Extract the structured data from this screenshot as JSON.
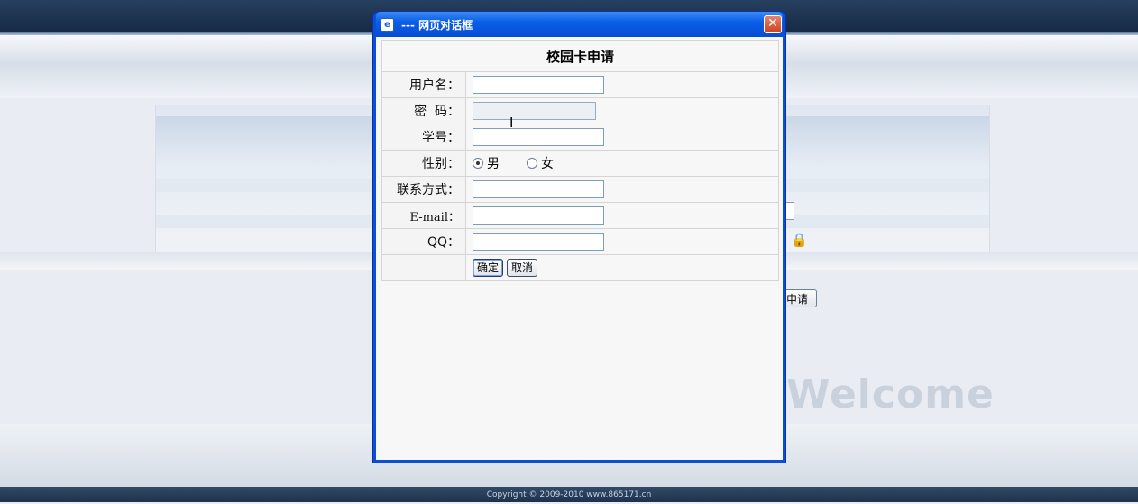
{
  "background": {
    "apply_button_label": "申请",
    "welcome_text": "Welcome",
    "footer_text": "Copyright © 2009-2010 www.865171.cn"
  },
  "dialog": {
    "title": "--- 网页对话框",
    "close_symbol": "✕",
    "icon": "ie-page-icon",
    "form_title": "校园卡申请",
    "fields": {
      "username_label": "用户名：",
      "username_value": "",
      "password_label": "密  码：",
      "password_value": "",
      "student_id_label": "学号：",
      "student_id_value": "",
      "gender_label": "性别：",
      "gender_options": [
        "男",
        "女"
      ],
      "gender_selected": "男",
      "contact_label": "联系方式：",
      "contact_value": "",
      "email_label": "E-mail：",
      "email_value": "",
      "qq_label": "QQ：",
      "qq_value": ""
    },
    "confirm_label": "确定",
    "cancel_label": "取消"
  }
}
